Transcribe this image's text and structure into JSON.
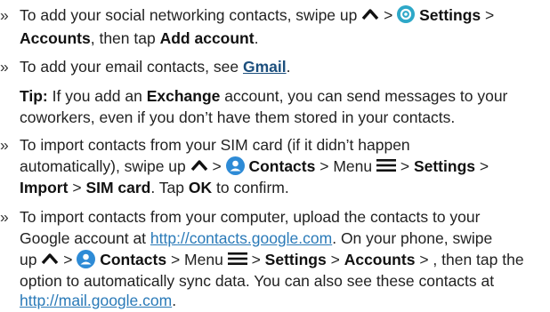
{
  "b1": {
    "bullet": "»",
    "t1": "To add your social networking contacts, swipe up",
    "sep1": ">",
    "settings": "Settings",
    "sep2": ">",
    "accounts": "Accounts",
    "t2": ", then tap",
    "add_account": "Add account",
    "end": "."
  },
  "b2": {
    "bullet": "»",
    "t1": "To add your email contacts, see",
    "gmail": "Gmail",
    "end": "."
  },
  "tip": {
    "label": "Tip:",
    "t1": "If you add an",
    "exchange": "Exchange",
    "t2": "account, you can send messages to your",
    "line2": "coworkers, even if you don’t have them stored in your contacts."
  },
  "b3": {
    "bullet": "»",
    "line1": "To import contacts from your SIM card (if it didn’t happen",
    "t1": "automatically), swipe up",
    "sep1": ">",
    "contacts": "Contacts",
    "t2": "> Menu",
    "sep2": ">",
    "settings": "Settings",
    "sep3": ">",
    "import": "Import",
    "sep4": ">",
    "sim": "SIM card",
    "t3": ". Tap",
    "ok": "OK",
    "t4": "to confirm."
  },
  "b4": {
    "bullet": "»",
    "line1": "To import contacts from your computer, upload the contacts to your",
    "t1": "Google account at",
    "url1": "http://contacts.google.com",
    "t2": ". On your phone, swipe",
    "up": "up",
    "sep1": ">",
    "contacts": "Contacts",
    "t3": "> Menu",
    "sep2": ">",
    "settings": "Settings",
    "sep3": ">",
    "accounts": "Accounts",
    "t4": "> , then tap the",
    "line5": "option to automatically sync data. You can also see these contacts at",
    "url2": "http://mail.google.com",
    "end": "."
  },
  "colors": {
    "link_bold": "#1c4f7d",
    "link_url": "#2a7ab8",
    "settings_icon": "#2ea8c8",
    "contacts_icon": "#2e8bd6"
  }
}
